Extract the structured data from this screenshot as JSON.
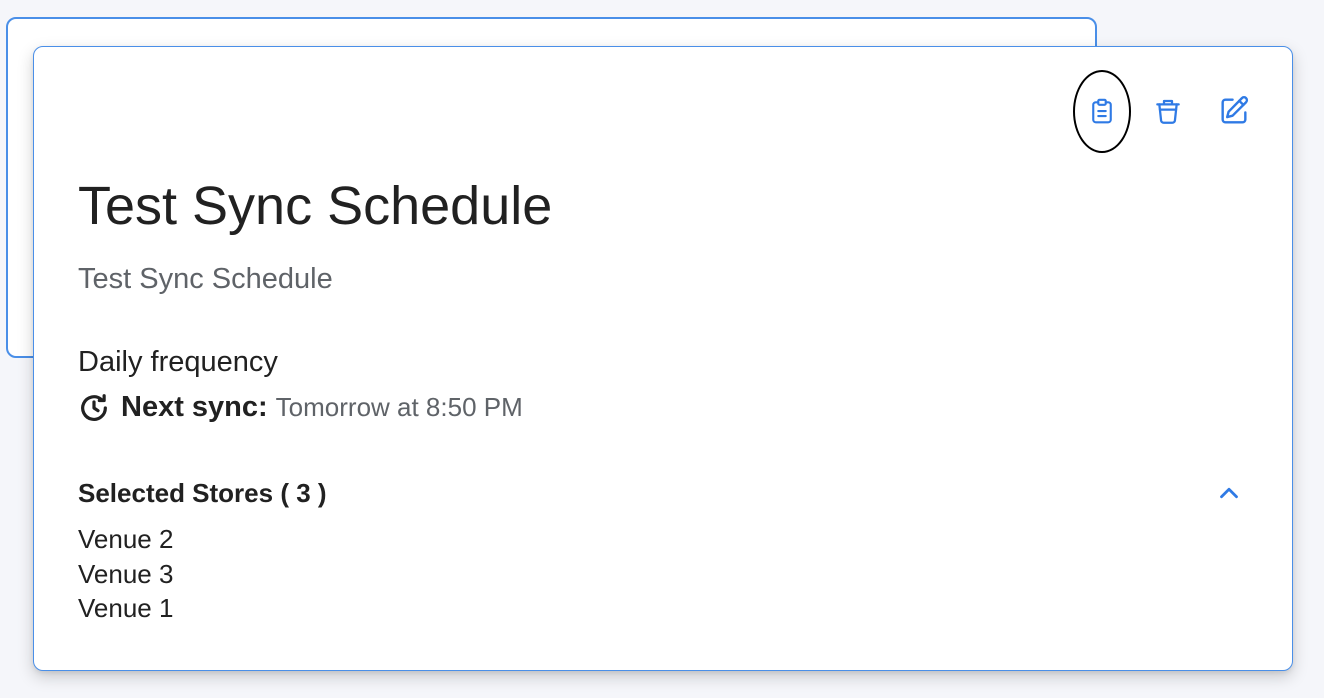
{
  "schedule": {
    "title": "Test Sync Schedule",
    "description": "Test Sync Schedule",
    "frequency": "Daily frequency",
    "next_sync_label": "Next sync:",
    "next_sync_value": "Tomorrow at 8:50 PM"
  },
  "toolbar": {
    "actions": [
      {
        "name": "clipboard-icon",
        "label": "Copy"
      },
      {
        "name": "trash-icon",
        "label": "Delete"
      },
      {
        "name": "edit-icon",
        "label": "Edit"
      }
    ]
  },
  "stores": {
    "header": "Selected Stores ( 3 )",
    "expanded": true,
    "items": [
      "Venue 2",
      "Venue 3",
      "Venue 1"
    ]
  },
  "colors": {
    "accent": "#2f7ae5",
    "border": "#4a8fe8",
    "text_primary": "#212121",
    "text_secondary": "#5f6368",
    "annotation": "#000000"
  }
}
